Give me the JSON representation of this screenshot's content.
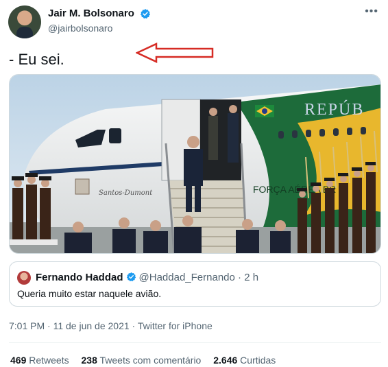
{
  "author": {
    "display_name": "Jair M. Bolsonaro",
    "handle": "@jairbolsonaro",
    "verified": true
  },
  "more_icon": "more-horizontal-icon",
  "tweet_text": "- Eu sei.",
  "annotation_color": "#d62b24",
  "media": {
    "plane_side_text": "REPÚB",
    "plane_lower_text": "FORÇA AÉREA BR",
    "plane_script_text": "Santos-Dumont"
  },
  "quoted_tweet": {
    "display_name": "Fernando Haddad",
    "handle": "@Haddad_Fernando",
    "separator": "·",
    "age": "2 h",
    "text": "Queria muito estar naquele avião."
  },
  "timestamp": "7:01 PM · 11 de jun de 2021 · Twitter for iPhone",
  "stats": [
    {
      "value": "469",
      "label": "Retweets"
    },
    {
      "value": "238",
      "label": "Tweets com comentário"
    },
    {
      "value": "2.646",
      "label": "Curtidas"
    }
  ],
  "colors": {
    "verified": "#1d9bf0",
    "secondary_text": "#536471",
    "border": "#cfd9de"
  }
}
